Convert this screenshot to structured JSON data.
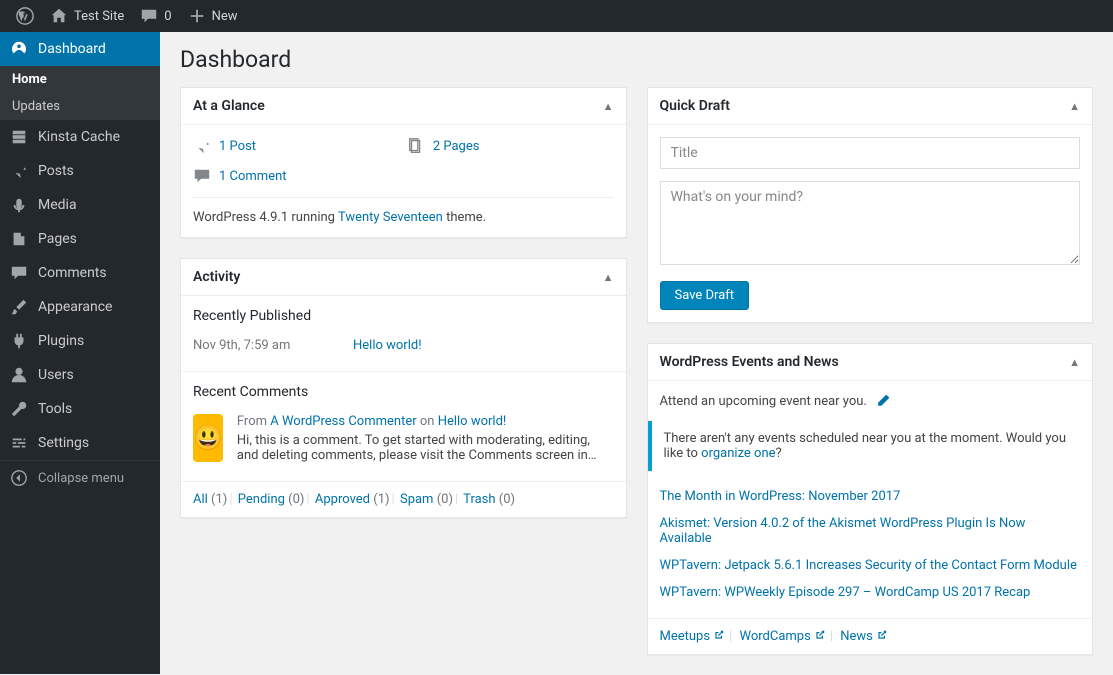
{
  "toolbar": {
    "site_name": "Test Site",
    "comment_count": "0",
    "new_label": "New"
  },
  "sidebar": {
    "items": [
      {
        "label": "Dashboard"
      },
      {
        "label": "Kinsta Cache"
      },
      {
        "label": "Posts"
      },
      {
        "label": "Media"
      },
      {
        "label": "Pages"
      },
      {
        "label": "Comments"
      },
      {
        "label": "Appearance"
      },
      {
        "label": "Plugins"
      },
      {
        "label": "Users"
      },
      {
        "label": "Tools"
      },
      {
        "label": "Settings"
      }
    ],
    "submenu": {
      "home": "Home",
      "updates": "Updates"
    },
    "collapse": "Collapse menu"
  },
  "page_title": "Dashboard",
  "glance": {
    "title": "At a Glance",
    "posts": "1 Post",
    "pages": "2 Pages",
    "comments": "1 Comment",
    "version_pre": "WordPress 4.9.1 running ",
    "theme": "Twenty Seventeen",
    "version_post": " theme."
  },
  "activity": {
    "title": "Activity",
    "published_h": "Recently Published",
    "pub_date": "Nov 9th, 7:59 am",
    "pub_title": "Hello world!",
    "recent_h": "Recent Comments",
    "from": "From ",
    "commenter": "A WordPress Commenter",
    "on": " on ",
    "on_post": "Hello world!",
    "comment_body": "Hi, this is a comment. To get started with moderating, editing, and deleting comments, please visit the Comments screen in…",
    "filters": {
      "all": "All",
      "all_c": "(1)",
      "pending": "Pending",
      "pending_c": "(0)",
      "approved": "Approved",
      "approved_c": "(1)",
      "spam": "Spam",
      "spam_c": "(0)",
      "trash": "Trash",
      "trash_c": "(0)"
    }
  },
  "quickdraft": {
    "title": "Quick Draft",
    "ph_title": "Title",
    "ph_body": "What's on your mind?",
    "save": "Save Draft"
  },
  "events": {
    "title": "WordPress Events and News",
    "attend": "Attend an upcoming event near you.",
    "notice_pre": "There aren't any events scheduled near you at the moment. Would you like to ",
    "notice_link": "organize one",
    "notice_post": "?",
    "news": [
      "The Month in WordPress: November 2017",
      "Akismet: Version 4.0.2 of the Akismet WordPress Plugin Is Now Available",
      "WPTavern: Jetpack 5.6.1 Increases Security of the Contact Form Module",
      "WPTavern: WPWeekly Episode 297 – WordCamp US 2017 Recap"
    ],
    "footer": {
      "meetups": "Meetups",
      "wordcamps": "WordCamps",
      "news": "News"
    }
  }
}
